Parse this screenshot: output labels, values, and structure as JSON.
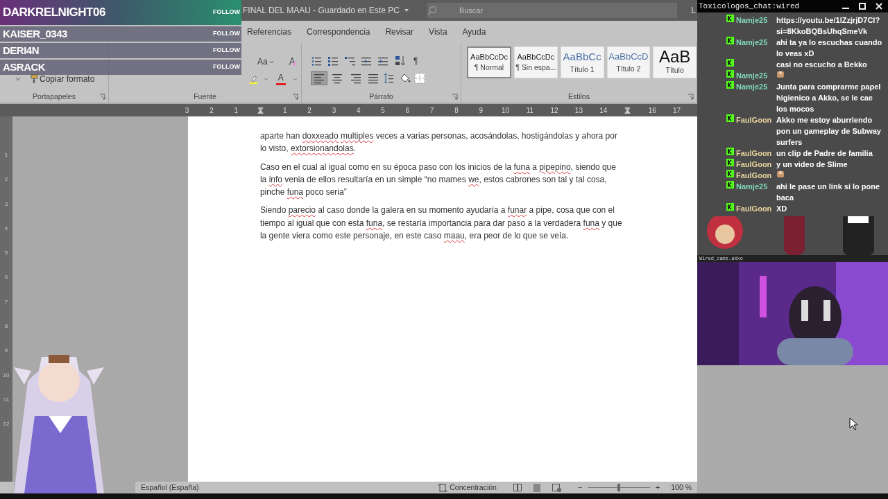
{
  "followers": [
    {
      "name": "DARKRELNIGHT06",
      "action": "FOLLOW",
      "highlight": true
    },
    {
      "name": "KAISER_0343",
      "action": "FOLLOW",
      "highlight": false
    },
    {
      "name": "DERI4N",
      "action": "FOLLOW",
      "highlight": false
    },
    {
      "name": "ASRACK",
      "action": "FOLLOW",
      "highlight": false
    }
  ],
  "word": {
    "title": "FINAL DEL MAAU  -  Guardado en Este PC",
    "search": {
      "placeholder": "Buscar"
    },
    "account": "L",
    "tabs": [
      {
        "label": "Referencias",
        "selected": false
      },
      {
        "label": "Correspondencia",
        "selected": false
      },
      {
        "label": "Revisar",
        "selected": false
      },
      {
        "label": "Vista",
        "selected": false
      },
      {
        "label": "Ayuda",
        "selected": false
      }
    ],
    "clipboard": {
      "format_painter": "Copiar formato",
      "group": "Portapapeles"
    },
    "font": {
      "change_case": "Aa",
      "group": "Fuente",
      "font_color_label": "A"
    },
    "paragraph": {
      "group": "Párrafo",
      "marks": "¶",
      "alignment": [
        {
          "kind": "left",
          "selected": true
        },
        {
          "kind": "center",
          "selected": false
        },
        {
          "kind": "right",
          "selected": false
        },
        {
          "kind": "justify",
          "selected": false
        }
      ]
    },
    "styles": {
      "group": "Estilos",
      "items": [
        {
          "sample": "AaBbCcDc",
          "name": "¶ Normal",
          "kind": "normal",
          "selected": true
        },
        {
          "sample": "AaBbCcDc",
          "name": "¶ Sin espa...",
          "kind": "normal",
          "selected": false
        },
        {
          "sample": "AaBbCc",
          "name": "Título 1",
          "kind": "heading",
          "selected": false
        },
        {
          "sample": "AaBbCcD",
          "name": "Título 2",
          "kind": "subheading",
          "selected": false
        },
        {
          "sample": "AaB",
          "name": "Título",
          "kind": "title",
          "selected": false
        }
      ]
    },
    "ruler": [
      {
        "label": "3"
      },
      {
        "label": "2"
      },
      {
        "label": "1"
      },
      {
        "kind": "indent"
      },
      {
        "label": "1"
      },
      {
        "label": "2"
      },
      {
        "label": "3"
      },
      {
        "label": "4"
      },
      {
        "label": "5"
      },
      {
        "label": "6"
      },
      {
        "label": "7"
      },
      {
        "label": "8"
      },
      {
        "label": "9"
      },
      {
        "label": "10"
      },
      {
        "label": "11"
      },
      {
        "label": "12"
      },
      {
        "label": "13"
      },
      {
        "label": "14"
      },
      {
        "kind": "indent"
      },
      {
        "label": "16"
      },
      {
        "label": "17"
      }
    ],
    "vruler": [
      "1",
      "2",
      "3",
      "4",
      "5",
      "6",
      "7",
      "8",
      "9",
      "10",
      "11",
      "12"
    ],
    "paragraphs": [
      [
        {
          "text": "aparte han "
        },
        {
          "text": "doxxeado",
          "misspelled": true
        },
        {
          "text": " multiples",
          "misspelled": true
        },
        {
          "text": " veces a varias personas, acosándolas, hostigándolas y ahora por lo visto, "
        },
        {
          "text": "extorsionandolas",
          "misspelled": true
        },
        {
          "text": "."
        }
      ],
      [
        {
          "text": "Caso en el cual al igual como en su época paso con los inicios de la "
        },
        {
          "text": "funa",
          "misspelled": true
        },
        {
          "text": " a "
        },
        {
          "text": "pipepino",
          "misspelled": true
        },
        {
          "text": ", siendo que la "
        },
        {
          "text": "info",
          "misspelled": true
        },
        {
          "text": " venia de ellos resultaría en un simple “no mames "
        },
        {
          "text": "we",
          "misspelled": true
        },
        {
          "text": ", estos cabrones son tal y tal cosa, pinche "
        },
        {
          "text": "funa",
          "misspelled": true
        },
        {
          "text": " poco seria”"
        }
      ],
      [
        {
          "text": "Siendo "
        },
        {
          "text": "parecio",
          "misspelled": true
        },
        {
          "text": " al caso donde la galera en su momento ayudaría a "
        },
        {
          "text": "funar",
          "misspelled": true
        },
        {
          "text": " a pipe, cosa que con el tiempo al igual que con esta "
        },
        {
          "text": "funa",
          "misspelled": true
        },
        {
          "text": ", se restaría importancia para dar paso a la verdadera "
        },
        {
          "text": "funa",
          "misspelled": true
        },
        {
          "text": " y que la gente viera como este personaje, en este caso "
        },
        {
          "text": "maau",
          "misspelled": true
        },
        {
          "text": ", era peor de lo que se veía."
        }
      ]
    ],
    "status": {
      "language": "Español (España)",
      "focus": "Concentración",
      "zoom_out": "−",
      "zoom_in": "+",
      "zoom": {
        "level": 0.5
      },
      "zoom_text": "100 %"
    }
  },
  "chat": {
    "title": "Toxicologos_chat:wired",
    "messages": [
      {
        "kind": "text",
        "user": "Namje25",
        "color": "#7fd8b8",
        "text": "https://youtu.be/1lZzjrjD7CI?si=8KkoBQBsUhqSmeVk"
      },
      {
        "kind": "text",
        "user": "Namje25",
        "color": "#7fd8b8",
        "text": "ahi ta ya lo escuchas cuando lo veas xD"
      },
      {
        "kind": "text",
        "text": "casi no escucho a Bekko"
      },
      {
        "kind": "emote",
        "user": "Namje25",
        "color": "#7fd8b8"
      },
      {
        "kind": "text",
        "user": "Namje25",
        "color": "#7fd8b8",
        "text": "Junta para comprarme papel higienico a Akko, se le cae los mocos"
      },
      {
        "kind": "text",
        "user": "FaulGoon",
        "color": "#e8d49c",
        "text": "Akko me estoy aburriendo pon un gameplay de Subway surfers"
      },
      {
        "kind": "text",
        "user": "FaulGoon",
        "color": "#e8d49c",
        "text": "un clip de Padre de familia"
      },
      {
        "kind": "text",
        "user": "FaulGoon",
        "color": "#e8d49c",
        "text": "y un video de Slime"
      },
      {
        "kind": "emote",
        "user": "FaulGoon",
        "color": "#e8d49c"
      },
      {
        "kind": "text",
        "user": "Namje25",
        "color": "#7fd8b8",
        "text": "ahi le pase un link si lo pone baca"
      },
      {
        "kind": "text",
        "user": "FaulGoon",
        "color": "#e8d49c",
        "text": "XD"
      }
    ]
  },
  "cam": {
    "title": "Wired_cams.akko"
  }
}
